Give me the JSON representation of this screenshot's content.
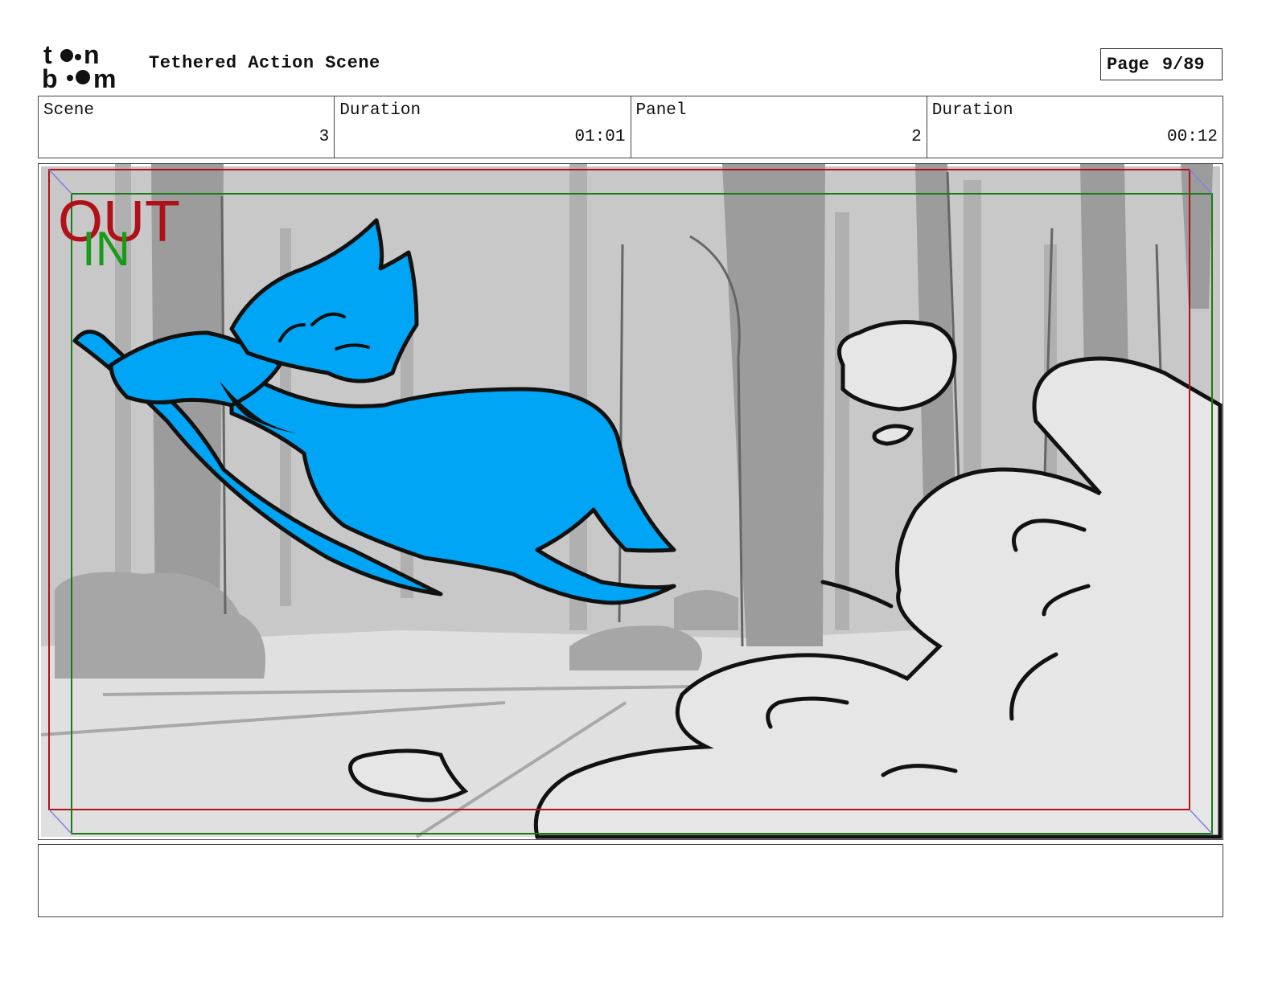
{
  "header": {
    "logo_text": "toon boom",
    "title": "Tethered Action Scene",
    "page_label": "Page",
    "page_value": "9/89"
  },
  "info": [
    {
      "label": "Scene",
      "value": "3"
    },
    {
      "label": "Duration",
      "value": "01:01"
    },
    {
      "label": "Panel",
      "value": "2"
    },
    {
      "label": "Duration",
      "value": "00:12"
    }
  ],
  "frame": {
    "out_label": "OUT",
    "in_label": "IN",
    "colors": {
      "out_frame": "#b01018",
      "in_frame": "#1a7a1a",
      "character": "#00a6f5",
      "background": "#c8c8c8",
      "trees_dark": "#9c9c9c",
      "trees_light": "#b0b0b0",
      "ground": "#e0e0e0",
      "smoke": "#e6e6e6"
    }
  },
  "notes": {
    "text": ""
  }
}
